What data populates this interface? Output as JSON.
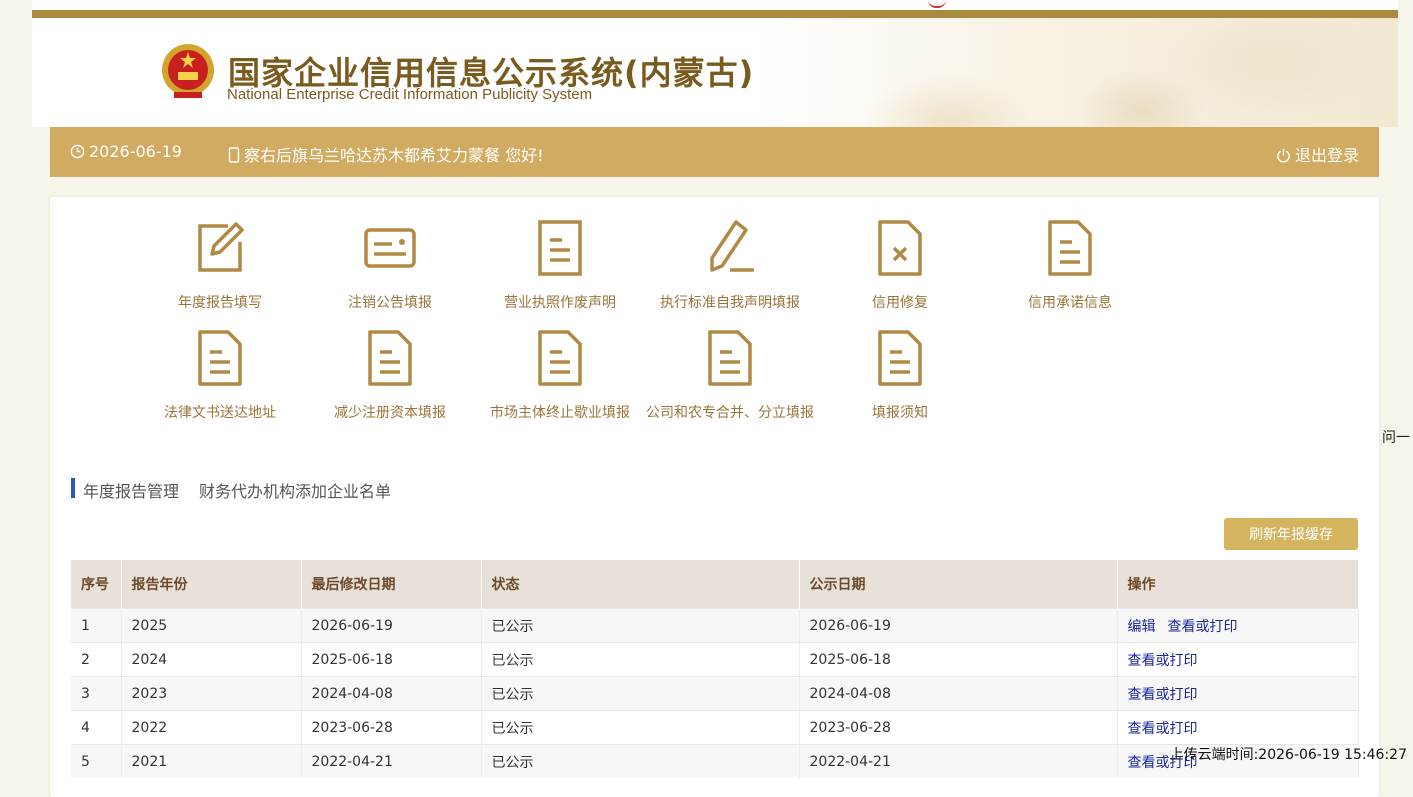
{
  "header": {
    "title": "国家企业信用信息公示系统(内蒙古)",
    "subtitle": "National Enterprise Credit Information Publicity System"
  },
  "userbar": {
    "date": "2026-06-19",
    "greeting": "察右后旗乌兰哈达苏木都希艾力蒙餐 您好!",
    "logout": "退出登录"
  },
  "functions": [
    {
      "label": "年度报告填写",
      "icon": "edit-icon"
    },
    {
      "label": "注销公告填报",
      "icon": "card-icon"
    },
    {
      "label": "营业执照作废声明",
      "icon": "document-icon"
    },
    {
      "label": "执行标准自我声明填报",
      "icon": "pencil-icon"
    },
    {
      "label": "信用修复",
      "icon": "document-x-icon"
    },
    {
      "label": "信用承诺信息",
      "icon": "document-icon"
    },
    {
      "label": "法律文书送达地址",
      "icon": "document-icon"
    },
    {
      "label": "减少注册资本填报",
      "icon": "document-icon"
    },
    {
      "label": "市场主体终止歇业填报",
      "icon": "document-icon"
    },
    {
      "label": "公司和农专合并、分立填报",
      "icon": "document-icon"
    },
    {
      "label": "填报须知",
      "icon": "document-icon"
    }
  ],
  "right_cut_text": "问一",
  "tabs": [
    "年度报告管理",
    "财务代办机构添加企业名单"
  ],
  "refresh_button": "刷新年报缓存",
  "table": {
    "headers": [
      "序号",
      "报告年份",
      "最后修改日期",
      "状态",
      "公示日期",
      "操作"
    ],
    "rows": [
      {
        "no": "1",
        "year": "2025",
        "modified": "2026-06-19",
        "status": "已公示",
        "published": "2026-06-19",
        "actions": [
          "编辑",
          "查看或打印"
        ]
      },
      {
        "no": "2",
        "year": "2024",
        "modified": "2025-06-18",
        "status": "已公示",
        "published": "2025-06-18",
        "actions": [
          "查看或打印"
        ]
      },
      {
        "no": "3",
        "year": "2023",
        "modified": "2024-04-08",
        "status": "已公示",
        "published": "2024-04-08",
        "actions": [
          "查看或打印"
        ]
      },
      {
        "no": "4",
        "year": "2022",
        "modified": "2023-06-28",
        "status": "已公示",
        "published": "2023-06-28",
        "actions": [
          "查看或打印"
        ]
      },
      {
        "no": "5",
        "year": "2021",
        "modified": "2022-04-21",
        "status": "已公示",
        "published": "2022-04-21",
        "actions": [
          "查看或打印"
        ]
      }
    ]
  },
  "upload_time": "上传云端时间:2026-06-19 15:46:27",
  "colors": {
    "accent_bar": "#d0ab61",
    "icon_gold": "#b08a44",
    "link": "#1a25a0",
    "tab_marker": "#2a5aa8"
  }
}
